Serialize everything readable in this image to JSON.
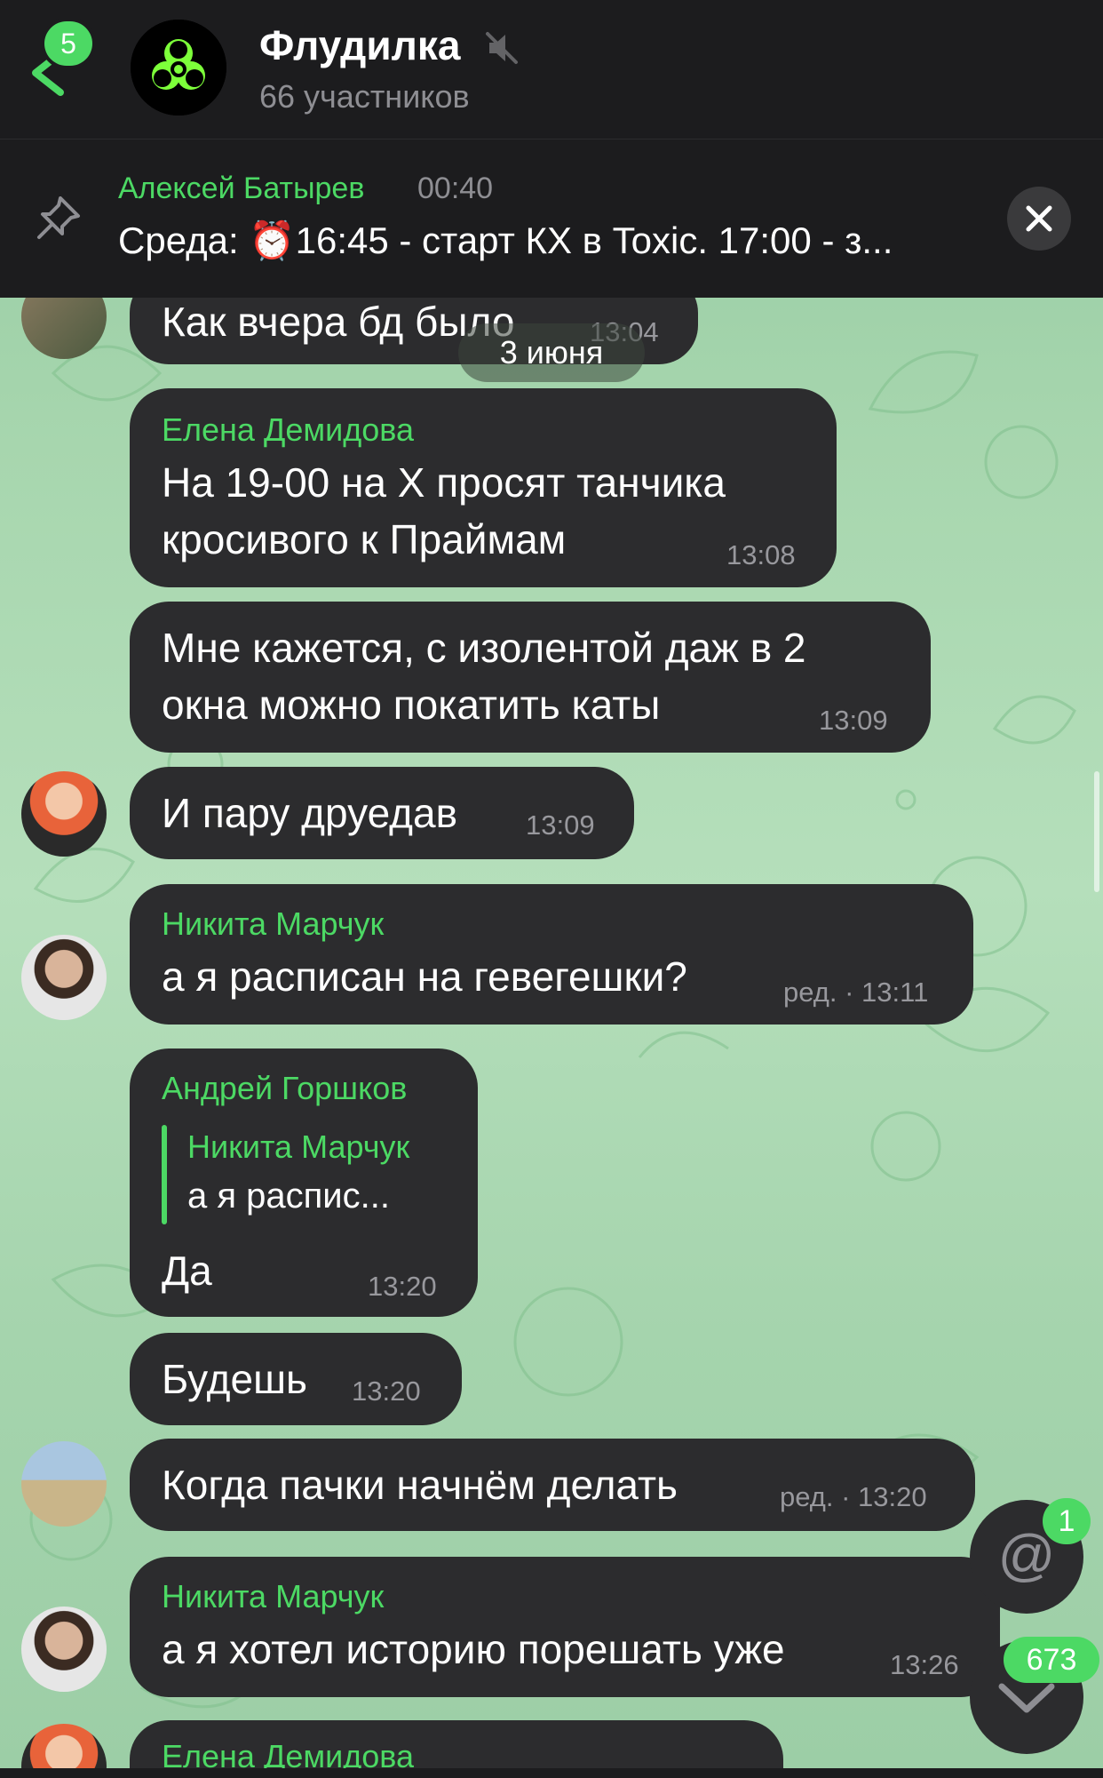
{
  "header": {
    "back_badge": "5",
    "title": "Флудилка",
    "subtitle": "66 участников",
    "accent_color": "#4cd964"
  },
  "pinned": {
    "author": "Алексей Батырев",
    "time": "00:40",
    "text": "Среда: ⏰16:45 - старт КХ в Toxic. 17:00 - з..."
  },
  "date_pill": "3 июня",
  "messages": [
    {
      "sender": "",
      "lines": [
        "Как вчера бд было"
      ],
      "time": "13:04"
    },
    {
      "sender": "Елена Демидова",
      "lines": [
        "На 19-00 на Х просят танчика",
        "кросивого к Праймам"
      ],
      "time": "13:08"
    },
    {
      "sender": "",
      "lines": [
        "Мне кажется, с изолентой даж в 2",
        "окна можно покатить каты"
      ],
      "time": "13:09"
    },
    {
      "sender": "",
      "lines": [
        "И пару друедав"
      ],
      "time": "13:09"
    },
    {
      "sender": "Никита Марчук",
      "lines": [
        "а я расписан на гевегешки?"
      ],
      "time": "ред. · 13:11"
    },
    {
      "sender": "Андрей Горшков",
      "reply_author": "Никита Марчук",
      "reply_text": "а я распис...",
      "lines": [
        "Да"
      ],
      "time": "13:20"
    },
    {
      "sender": "",
      "lines": [
        "Будешь"
      ],
      "time": "13:20"
    },
    {
      "sender": "",
      "lines": [
        "Когда пачки начнём делать"
      ],
      "time": "ред. · 13:20"
    },
    {
      "sender": "Никита Марчук",
      "lines": [
        "а я хотел историю порешать уже"
      ],
      "time": "13:26"
    },
    {
      "sender": "Елена Демидова",
      "lines": [],
      "time": ""
    }
  ],
  "mention_button": {
    "icon": "@",
    "badge": "1"
  },
  "scroll_down_button": {
    "badge": "673"
  }
}
